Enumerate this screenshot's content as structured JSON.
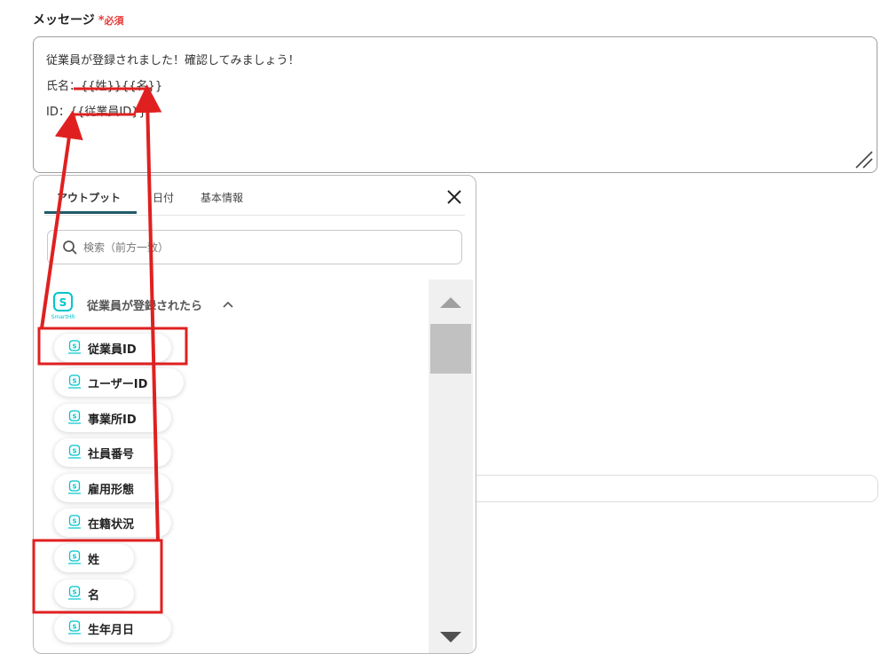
{
  "field": {
    "label": "メッセージ",
    "required_star": "*",
    "required_text": "必須"
  },
  "message": {
    "lines": [
      "従業員が登録されました！確認してみましょう！",
      "氏名：{{姓}}{{名}}",
      "ID：{{従業員ID}}"
    ]
  },
  "panel": {
    "tabs": [
      {
        "label": "アウトプット",
        "active": true
      },
      {
        "label": "日付",
        "active": false
      },
      {
        "label": "基本情報",
        "active": false
      }
    ],
    "search": {
      "placeholder": "検索（前方一致）"
    },
    "group": {
      "title": "従業員が登録されたら",
      "logo_text": "SmartHR"
    },
    "items": [
      {
        "label": "従業員ID"
      },
      {
        "label": "ユーザーID"
      },
      {
        "label": "事業所ID"
      },
      {
        "label": "社員番号"
      },
      {
        "label": "雇用形態"
      },
      {
        "label": "在籍状況"
      },
      {
        "label": "姓"
      },
      {
        "label": "名"
      },
      {
        "label": "生年月日"
      }
    ]
  },
  "colors": {
    "accent": "#1f5c6b",
    "annotation_red": "#e02020",
    "required_red": "#e53935",
    "smarthr_teal": "#00c4cc"
  }
}
